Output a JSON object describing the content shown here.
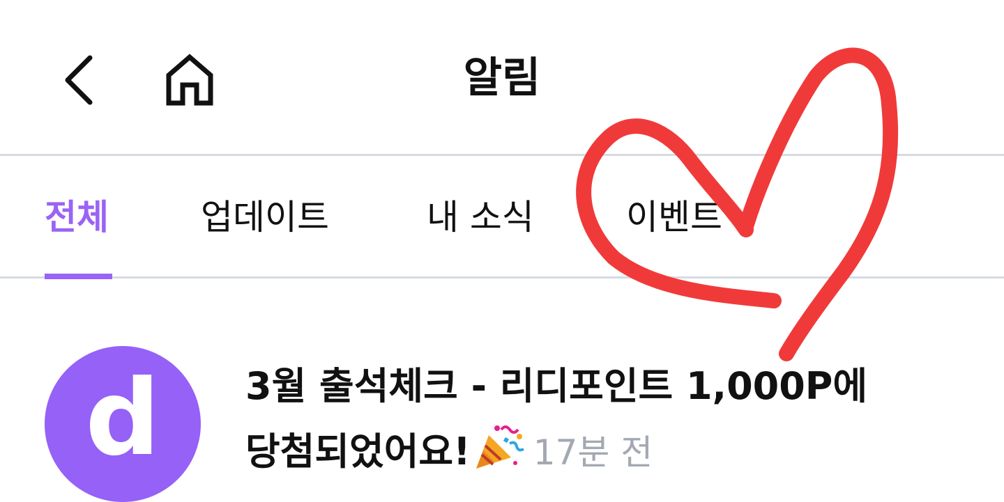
{
  "header": {
    "title": "알림",
    "back_icon": "chevron-left-icon",
    "home_icon": "home-icon"
  },
  "tabs": [
    {
      "label": "전체",
      "active": true
    },
    {
      "label": "업데이트",
      "active": false
    },
    {
      "label": "내 소식",
      "active": false
    },
    {
      "label": "이벤트",
      "active": false
    }
  ],
  "notifications": [
    {
      "avatar_letter": "d",
      "title_line1": "3월 출석체크 - 리디포인트 1,000P에",
      "title_line2": "당첨되었어요!",
      "emoji_icon": "party-popper-icon",
      "time": "17분 전"
    }
  ],
  "colors": {
    "accent": "#9a63f5",
    "avatar_bg": "#9561f7",
    "divider": "#d6dbe2",
    "time_text": "#a3a9b1",
    "doodle": "#f03a3a"
  },
  "overlay": {
    "doodle_icon": "heart-doodle-icon"
  }
}
